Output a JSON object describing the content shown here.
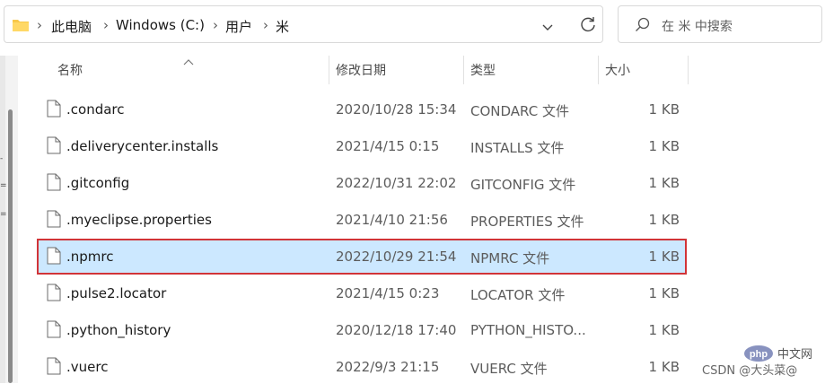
{
  "breadcrumb": {
    "items": [
      "此电脑",
      "Windows (C:)",
      "用户",
      "米"
    ]
  },
  "search": {
    "placeholder": "在 米 中搜索"
  },
  "columns": {
    "name": "名称",
    "modified": "修改日期",
    "type": "类型",
    "size": "大小"
  },
  "files": [
    {
      "name": ".condarc",
      "modified": "2020/10/28 15:34",
      "type": "CONDARC 文件",
      "size": "1 KB",
      "selected": false
    },
    {
      "name": ".deliverycenter.installs",
      "modified": "2021/4/15 0:15",
      "type": "INSTALLS 文件",
      "size": "1 KB",
      "selected": false
    },
    {
      "name": ".gitconfig",
      "modified": "2022/10/31 22:02",
      "type": "GITCONFIG 文件",
      "size": "1 KB",
      "selected": false
    },
    {
      "name": ".myeclipse.properties",
      "modified": "2021/4/10 21:56",
      "type": "PROPERTIES 文件",
      "size": "1 KB",
      "selected": false
    },
    {
      "name": ".npmrc",
      "modified": "2022/10/29 21:54",
      "type": "NPMRC 文件",
      "size": "1 KB",
      "selected": true
    },
    {
      "name": ".pulse2.locator",
      "modified": "2021/4/15 0:23",
      "type": "LOCATOR 文件",
      "size": "1 KB",
      "selected": false
    },
    {
      "name": ".python_history",
      "modified": "2020/12/18 17:40",
      "type": "PYTHON_HISTO...",
      "size": "1 KB",
      "selected": false
    },
    {
      "name": ".vuerc",
      "modified": "2022/9/3 21:15",
      "type": "VUERC 文件",
      "size": "1 KB",
      "selected": false
    }
  ],
  "watermark": {
    "logo": "php 中文网",
    "text": "CSDN @大头菜@"
  },
  "colors": {
    "selection_bg": "#cce8ff",
    "highlight_border": "#d13438"
  }
}
